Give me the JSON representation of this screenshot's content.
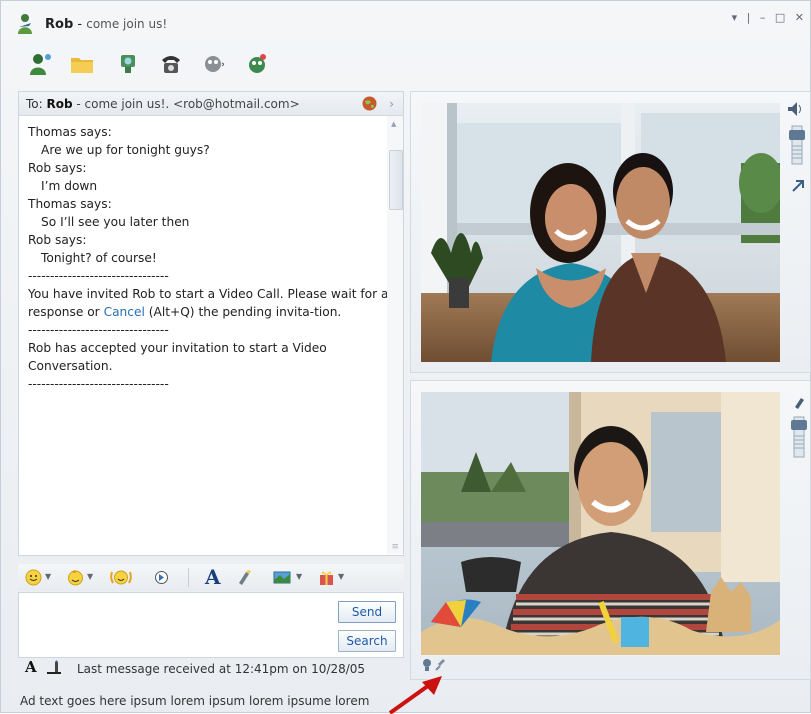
{
  "window": {
    "contact_name": "Rob",
    "title_separator": " - ",
    "contact_status": "come join us!",
    "controls": [
      "▾",
      "|",
      "–",
      "□",
      "✕"
    ]
  },
  "toolbar": {
    "icons": [
      "invite-contact-icon",
      "send-files-icon",
      "webcam-icon",
      "phone-call-icon",
      "activities-icon",
      "games-icon"
    ]
  },
  "chat": {
    "to_prefix": "To: ",
    "to_name": "Rob",
    "to_rest": " - come join us!. <rob@hotmail.com>",
    "messages": [
      {
        "text": "Thomas says:",
        "indent": false
      },
      {
        "text": "Are we up for tonight guys?",
        "indent": true
      },
      {
        "text": "Rob says:",
        "indent": false
      },
      {
        "text": "I’m down",
        "indent": true
      },
      {
        "text": "Thomas says:",
        "indent": false
      },
      {
        "text": "So I’ll see you later then",
        "indent": true
      },
      {
        "text": "Rob says:",
        "indent": false
      },
      {
        "text": "Tonight? of course!",
        "indent": true
      },
      {
        "text": "--------------------------------",
        "indent": false
      }
    ],
    "invite_before": "You have invited Rob to start a Video Call. Please wait for a response or ",
    "invite_link": "Cancel",
    "invite_after": " (Alt+Q) the pending invita-tion.",
    "divider": "--------------------------------",
    "accepted": "Rob has accepted your invitation to start a Video Conversation.",
    "divider2": "--------------------------------"
  },
  "input": {
    "send_label": "Send",
    "search_label": "Search"
  },
  "status_bar": {
    "format_glyph": "A",
    "last_message": "Last message received at 12:41pm on 10/28/05"
  },
  "ad_text": "Ad text goes here ipsum lorem ipsum lorem ipsume lorem",
  "colors": {
    "link": "#2a6fb7",
    "button_text": "#1f5aa8",
    "arrow": "#cc1111"
  }
}
